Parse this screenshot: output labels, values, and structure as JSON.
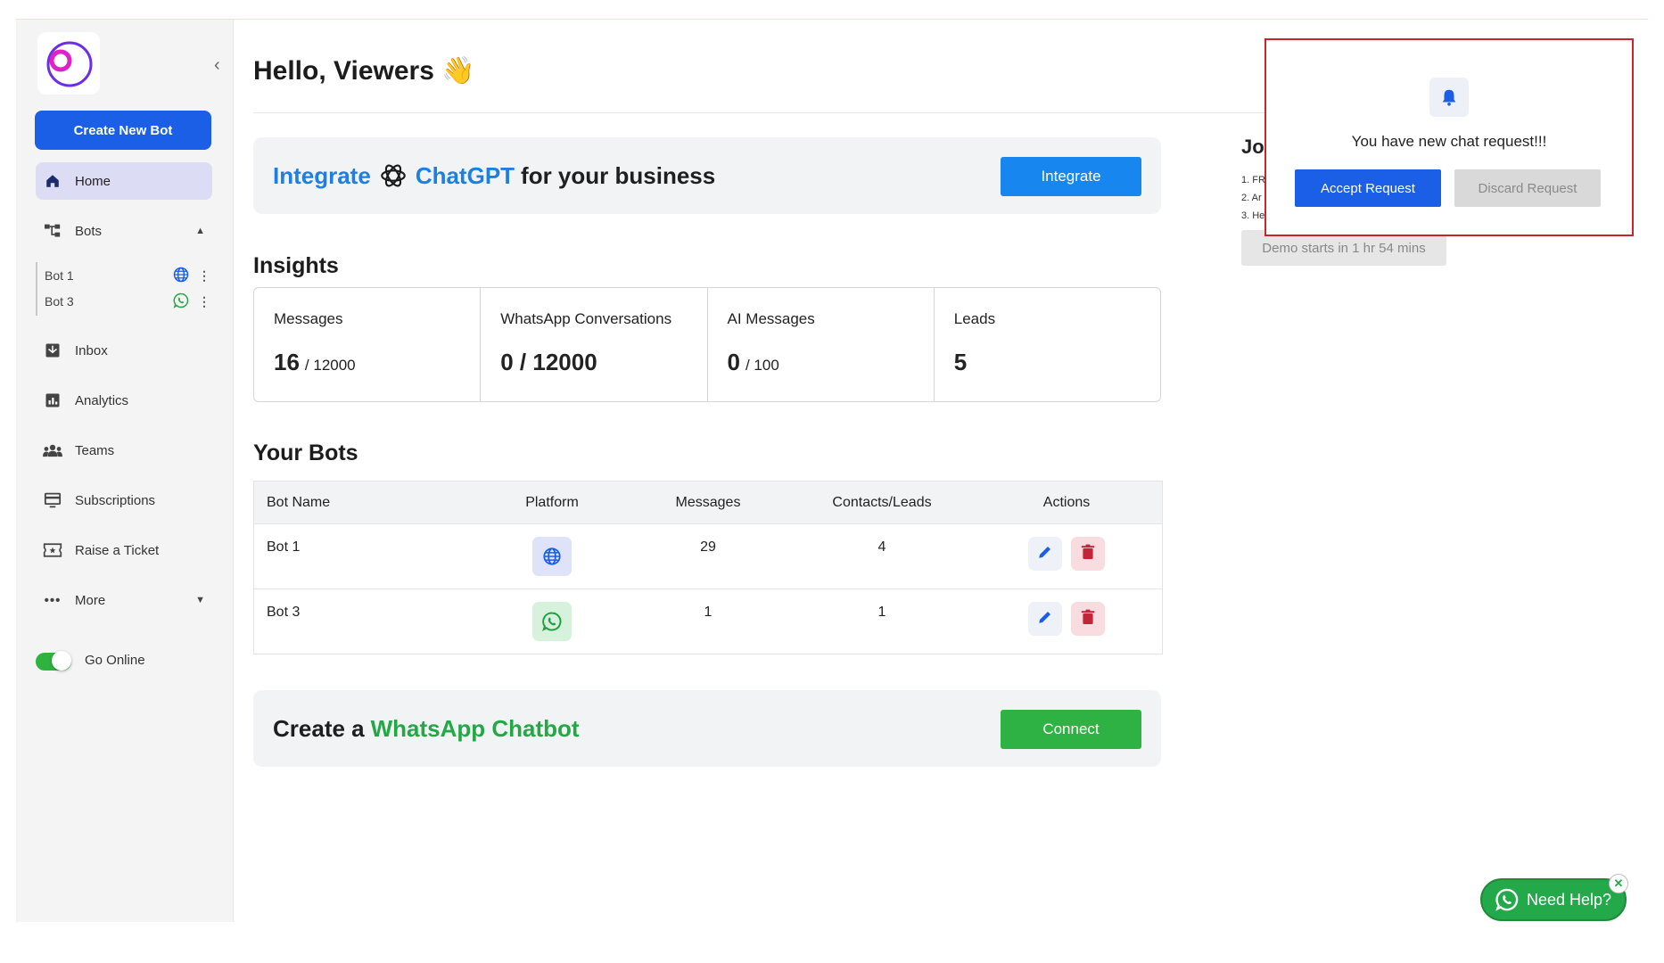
{
  "sidebar": {
    "create_label": "Create New Bot",
    "nav": {
      "home": "Home",
      "bots": "Bots",
      "inbox": "Inbox",
      "analytics": "Analytics",
      "teams": "Teams",
      "subscriptions": "Subscriptions",
      "ticket": "Raise a Ticket",
      "more": "More"
    },
    "bots": [
      {
        "label": "Bot 1",
        "platform_icon": "globe-icon"
      },
      {
        "label": "Bot 3",
        "platform_icon": "whatsapp-icon"
      }
    ],
    "go_online_label": "Go Online",
    "go_online_state": "on"
  },
  "main": {
    "greeting": "Hello, Viewers 👋",
    "integrate_banner": {
      "word_integrate": "Integrate",
      "word_chatgpt": "ChatGPT",
      "word_rest": "for your business",
      "button": "Integrate"
    },
    "insights": {
      "title": "Insights",
      "cards": [
        {
          "label": "Messages",
          "value": "16",
          "suffix": "/ 12000"
        },
        {
          "label": "WhatsApp Conversations",
          "value": "0 / 12000",
          "suffix": ""
        },
        {
          "label": "AI Messages",
          "value": "0",
          "suffix": "/ 100"
        },
        {
          "label": "Leads",
          "value": "5",
          "suffix": ""
        }
      ]
    },
    "bots_table": {
      "title": "Your Bots",
      "headers": [
        "Bot Name",
        "Platform",
        "Messages",
        "Contacts/Leads",
        "Actions"
      ],
      "rows": [
        {
          "name": "Bot 1",
          "platform": "globe-icon",
          "messages": "29",
          "contacts": "4"
        },
        {
          "name": "Bot 3",
          "platform": "whatsapp-icon",
          "messages": "1",
          "contacts": "1"
        }
      ]
    },
    "whatsapp_banner": {
      "word_create": "Create a",
      "word_whatsapp": "WhatsApp Chatbot",
      "button": "Connect"
    }
  },
  "right_panel": {
    "join_title": "Joi",
    "list": [
      "1. FR",
      "2. Ar",
      "3. He"
    ],
    "demo_label": "Demo starts in 1 hr 54 mins"
  },
  "popup": {
    "message": "You have new chat request!!!",
    "accept": "Accept Request",
    "discard": "Discard Request"
  },
  "help": {
    "label": "Need Help?",
    "close": "✕"
  },
  "colors": {
    "primary": "#1a5fe6",
    "chatgpt_blue": "#1e7fe0",
    "whatsapp_green": "#23a846",
    "danger": "#c9252b"
  }
}
